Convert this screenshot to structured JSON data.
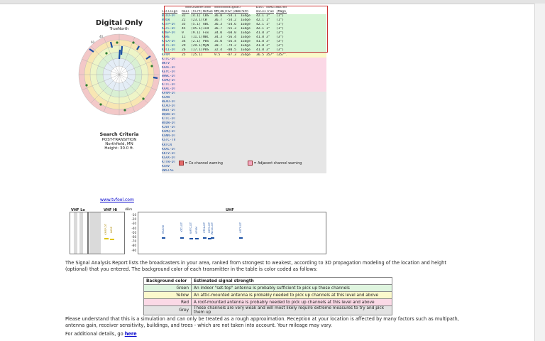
{
  "page": {
    "left_panel": {
      "title": "Digital Only",
      "north_label": "TrueNorth",
      "search_criteria_title": "Search Criteria",
      "criteria": [
        "POST-TRANSITION",
        "Northfield, MN",
        "Height: 30.0 ft."
      ]
    },
    "table": {
      "group_headers": [
        "===Channel===",
        "=======Signal=======",
        "Dist",
        "==Azimuth=="
      ],
      "columns": [
        "Callsign",
        "Real",
        "(Virt)",
        "Netwk",
        "NM(dB)",
        "Pwr(dBm)",
        "Path",
        "miles",
        "True",
        "(Magn)"
      ],
      "rows": [
        [
          "WCCO-DT",
          "32",
          "(4.1)",
          "CBS",
          "36.8",
          "-54.1",
          "1Edge",
          "42.1",
          "1°",
          "(1°)"
        ],
        [
          "WUCW",
          "22",
          "(23.1)",
          "CW",
          "36.7",
          "-54.2",
          "1Edge",
          "42.1",
          "1°",
          "(1°)"
        ],
        [
          "KSTP-DT",
          "35",
          "(5.1)",
          "ABC",
          "36.3",
          "-54.6",
          "1Edge",
          "42.1",
          "1°",
          "(1°)"
        ],
        [
          "KSTC-DT",
          "45",
          "(45.1)",
          "Ind",
          "36.7",
          "-55.3",
          "1Edge",
          "42.1",
          "1°",
          "(1°)"
        ],
        [
          "KMSP-DT",
          "9",
          "(9.1)",
          "Fox",
          "34.0",
          "-60.0",
          "1Edge",
          "41.8",
          "3°",
          "(3°)"
        ],
        [
          "KARE",
          "11",
          "(11.1)",
          "NBC",
          "34.3",
          "-56.4",
          "1Edge",
          "41.8",
          "3°",
          "(3°)"
        ],
        [
          "KTCA-DT",
          "34",
          "(2.1)",
          "PBS",
          "35.0",
          "-56.4",
          "1Edge",
          "41.8",
          "3°",
          "(3°)"
        ],
        [
          "WFTC-DT",
          "29",
          "(29.1)",
          "MyN",
          "30.7",
          "-79.2",
          "1Edge",
          "41.8",
          "3°",
          "(3°)"
        ],
        [
          "KTCI-DT",
          "26",
          "(17.1)",
          "PBS",
          "32.4",
          "-80.5",
          "1Edge",
          "41.8",
          "3°",
          "(3°)"
        ],
        [
          "KPXM",
          "25",
          "(25.1)",
          "",
          "9.5",
          "-87.3",
          "2Edge",
          "36.5",
          "357°",
          "(357°)"
        ],
        [
          "KTTC-DT",
          "",
          "",
          "",
          "",
          "",
          "",
          "",
          "",
          ""
        ],
        [
          "WKTV",
          "",
          "",
          "",
          "",
          "",
          "",
          "",
          "",
          ""
        ],
        [
          "KAAL-DT",
          "",
          "",
          "",
          "",
          "",
          "",
          "",
          "",
          ""
        ],
        [
          "KEYC-DT",
          "",
          "",
          "",
          "",
          "",
          "",
          "",
          "",
          ""
        ],
        [
          "WHWC-DT",
          "",
          "",
          "",
          "",
          "",
          "",
          "",
          "",
          ""
        ],
        [
          "KSMQ-DT",
          "",
          "",
          "",
          "",
          "",
          "",
          "",
          "",
          ""
        ],
        [
          "KTTC-DT",
          "",
          "",
          "",
          "",
          "",
          "",
          "",
          "",
          ""
        ],
        [
          "KAAL-DT",
          "",
          "",
          "",
          "",
          "",
          "",
          "",
          "",
          ""
        ],
        [
          "KPXM-DT",
          "",
          "",
          "",
          "",
          "",
          "",
          "",
          "",
          ""
        ],
        [
          "KSAW",
          "",
          "",
          "",
          "",
          "",
          "",
          "",
          "",
          ""
        ],
        [
          "WEAU-DT",
          "",
          "",
          "",
          "",
          "",
          "",
          "",
          "",
          ""
        ],
        [
          "KCAU-DT",
          "",
          "",
          "",
          "",
          "",
          "",
          "",
          "",
          ""
        ],
        [
          "WKBT-DT",
          "",
          "",
          "",
          "",
          "",
          "",
          "",
          "",
          ""
        ],
        [
          "WQOW-DT",
          "",
          "",
          "",
          "",
          "",
          "",
          "",
          "",
          ""
        ],
        [
          "KTTC-DT",
          "",
          "",
          "",
          "",
          "",
          "",
          "",
          "",
          ""
        ],
        [
          "WXOW-DT",
          "",
          "",
          "",
          "",
          "",
          "",
          "",
          "",
          ""
        ],
        [
          "KJWT-DT",
          "",
          "",
          "",
          "",
          "",
          "",
          "",
          "",
          ""
        ],
        [
          "KSMQ-DT",
          "",
          "",
          "",
          "",
          "",
          "",
          "",
          "",
          ""
        ],
        [
          "KSNN-DT",
          "",
          "",
          "",
          "",
          "",
          "",
          "",
          "",
          ""
        ],
        [
          "KSTC-TV",
          "",
          "",
          "",
          "",
          "",
          "",
          "",
          "",
          ""
        ],
        [
          "KRTCN",
          "",
          "",
          "",
          "",
          "",
          "",
          "",
          "",
          ""
        ],
        [
          "KAAL-DT",
          "",
          "",
          "",
          "",
          "",
          "",
          "",
          "",
          ""
        ],
        [
          "KKTV-DT",
          "",
          "",
          "",
          "",
          "",
          "",
          "",
          "",
          ""
        ],
        [
          "KSAX-DT",
          "",
          "",
          "",
          "",
          "",
          "",
          "",
          "",
          ""
        ],
        [
          "KTTW-DT",
          "",
          "",
          "",
          "",
          "",
          "",
          "",
          "",
          ""
        ],
        [
          "KSRV",
          "",
          "",
          "",
          "",
          "",
          "",
          "",
          "",
          ""
        ],
        [
          "DWSTAS",
          "",
          "",
          "",
          "",
          "",
          "",
          "",
          "",
          ""
        ]
      ],
      "row_colors": [
        "#d7f5d7",
        "#d7f5d7",
        "#d7f5d7",
        "#d7f5d7",
        "#d7f5d7",
        "#d7f5d7",
        "#d7f5d7",
        "#d7f5d7",
        "#d7f5d7",
        "#fbf9c8",
        "#fbd8e6",
        "#fbd8e6",
        "#fbd8e6",
        "#fbd8e6",
        "#fbd8e6",
        "#fbd8e6",
        "#fbd8e6",
        "#fbd8e6",
        "#e6e6e6",
        "#e6e6e6",
        "#e6e6e6",
        "#e6e6e6",
        "#e6e6e6",
        "#e6e6e6",
        "#e6e6e6",
        "#e6e6e6",
        "#e6e6e6",
        "#e6e6e6",
        "#e6e6e6",
        "#e6e6e6",
        "#e6e6e6",
        "#e6e6e6",
        "#e6e6e6",
        "#e6e6e6",
        "#e6e6e6",
        "#e6e6e6",
        "#e6e6e6"
      ],
      "legend": [
        {
          "text": "= Co-channel warning",
          "color": "#e36a6a"
        },
        {
          "text": "= Adjacent channel warning",
          "color": "#f3a7c2"
        }
      ]
    },
    "site_link": "www.tvfool.com",
    "spectrum": {
      "bands": [
        "VHF Lo",
        "VHF Hi",
        "UHF"
      ],
      "unit": "dBm",
      "yticks": [
        "-10",
        "-20",
        "-30",
        "-40",
        "-50",
        "-60",
        "-70",
        "-80",
        "-90"
      ],
      "vhf_hi_stations": [
        "KMSP-DT",
        "KARE"
      ],
      "uhf_stations": [
        "WUCW",
        "KTCI-DT",
        "WFTC-DT",
        "KPXM",
        "KTCA-DT",
        "KSTC-DT",
        "WCCO-DT",
        "KSTP-DT"
      ]
    },
    "description": "The Signal Analysis Report lists the broadcasters in your area, ranked from strongest to weakest, according to 3D propagation modeling of the location and height (optional) that you entered.  The background color of each transmitter in the table is color coded as follows:",
    "strength_table": {
      "header": [
        "Background color",
        "Estimated signal strength"
      ],
      "rows": [
        {
          "label": "Green",
          "text": "An indoor \"set-top\" antenna is probably sufficient to pick up these channels",
          "color": "#dff5df"
        },
        {
          "label": "Yellow",
          "text": "An attic-mounted antenna is probably needed to pick up channels at this level and above",
          "color": "#fbf9cc"
        },
        {
          "label": "Red",
          "text": "A roof-mounted antenna is probably needed to pick up channels at this level and above",
          "color": "#fbd9e6"
        },
        {
          "label": "Grey",
          "text": "These channels are very weak and will most likely require extreme measures to try and pick them up",
          "color": "#e3e3e3"
        }
      ]
    },
    "disclaimer": "Please understand that this is a simulation and can only be treated as a rough approximation.  Reception at your location is affected by many factors such as multipath, antenna gain, receiver sensitivity, buildings, and trees - which are not taken into account.  Your mileage may vary.",
    "details_prefix": "For additional details, go ",
    "details_link": "here"
  }
}
